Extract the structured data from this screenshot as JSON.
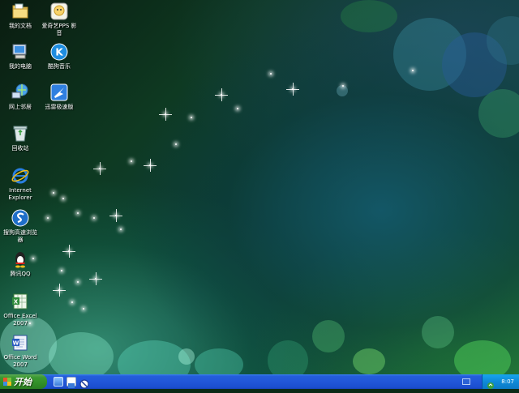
{
  "desktop": {
    "icons": [
      {
        "label": "我的文档",
        "icon": "my-documents-icon"
      },
      {
        "label": "爱奇艺PPS 影\n音",
        "icon": "iqiyi-pps-icon"
      },
      {
        "label": "我的电脑",
        "icon": "my-computer-icon"
      },
      {
        "label": "酷狗音乐",
        "icon": "kugou-music-icon"
      },
      {
        "label": "网上邻居",
        "icon": "network-places-icon"
      },
      {
        "label": "迅雷极速版",
        "icon": "xunlei-icon"
      },
      {
        "label": "回收站",
        "icon": "recycle-bin-icon"
      },
      {
        "label": "Internet\nExplorer",
        "icon": "internet-explorer-icon"
      },
      {
        "label": "搜狗高速浏览\n器",
        "icon": "sogou-browser-icon"
      },
      {
        "label": "腾讯QQ",
        "icon": "tencent-qq-icon"
      },
      {
        "label": "Office Excel\n2007",
        "icon": "excel-icon"
      },
      {
        "label": "Office Word\n2007",
        "icon": "word-icon"
      }
    ]
  },
  "taskbar": {
    "start_label": "开始",
    "quick_launch": [
      "show-desktop-ql-icon",
      "media-ql-icon",
      "block-ql-icon"
    ],
    "clock": "8:07",
    "colors": {
      "taskbar": "#245edb",
      "start": "#3c9a33",
      "tray": "#0f8ad8"
    }
  }
}
